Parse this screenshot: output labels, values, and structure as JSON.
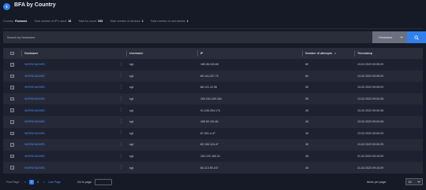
{
  "header": {
    "title": "BFA by Country"
  },
  "summary": [
    {
      "label": "Country:",
      "value": "Romania"
    },
    {
      "label": "Total number of IP's used:",
      "value": "18"
    },
    {
      "label": "Total for count:",
      "value": "535"
    },
    {
      "label": "Total number of devices:",
      "value": "1"
    },
    {
      "label": "Total number of usernames:",
      "value": "1"
    }
  ],
  "search": {
    "placeholder": "Search by Hostname",
    "field": "Hostname"
  },
  "table": {
    "columns": [
      "Hostname",
      "Username",
      "IP",
      "Number of attempts",
      "Timestamp"
    ],
    "rows": [
      {
        "hostname": "WORKHAZARD",
        "username": "sg1",
        "ip": "185.36.243.65",
        "attempts": "60",
        "timestamp": "13.02.2023 09:05:29"
      },
      {
        "hostname": "WORKHAZARD",
        "username": "sg1",
        "ip": "89.141.207.72",
        "attempts": "60",
        "timestamp": "13.02.2023 09:05:29"
      },
      {
        "hostname": "WORKHAZARD",
        "username": "sg1",
        "ip": "86.121.12.36",
        "attempts": "55",
        "timestamp": "13.02.2023 09:05:29"
      },
      {
        "hostname": "WORKHAZARD",
        "username": "sg1",
        "ip": "109.234.100.164",
        "attempts": "55",
        "timestamp": "13.02.2023 09:00:28"
      },
      {
        "hostname": "WORKHAZARD",
        "username": "sg1",
        "ip": "91.245.254.174",
        "attempts": "45",
        "timestamp": "13.02.2023 09:00:28"
      },
      {
        "hostname": "WORKHAZARD",
        "username": "sg1",
        "ip": "185.92.191.81",
        "attempts": "45",
        "timestamp": "13.02.2023 09:00:28"
      },
      {
        "hostname": "WORKHAZARD",
        "username": "sg1",
        "ip": "87.251.4.47",
        "attempts": "45",
        "timestamp": "13.02.2023 09:00:29"
      },
      {
        "hostname": "WORKHAZARD",
        "username": "sg1",
        "ip": "82.196.124.47",
        "attempts": "45",
        "timestamp": "13.02.2023 09:00:29"
      },
      {
        "hostname": "WORKHAZARD",
        "username": "sg1",
        "ip": "152.120.160.31",
        "attempts": "45",
        "timestamp": "21.02.2023 09:15:29"
      },
      {
        "hostname": "WORKHAZARD",
        "username": "sg1",
        "ip": "84.113.90.247",
        "attempts": "45",
        "timestamp": "21.02.2023 09:15:29"
      }
    ]
  },
  "pagination": {
    "first": "First Page",
    "prev": "<",
    "current": "1",
    "page2": "2",
    "next": ">",
    "last": "Last Page",
    "goto_label": "Go to page:",
    "items_per_page_label": "Items per page:",
    "items_per_page": "10"
  },
  "colors": {
    "background": "#161a26",
    "accent": "#2f80ed",
    "link": "#4f8ef7",
    "header_row": "#2a2e3b"
  }
}
